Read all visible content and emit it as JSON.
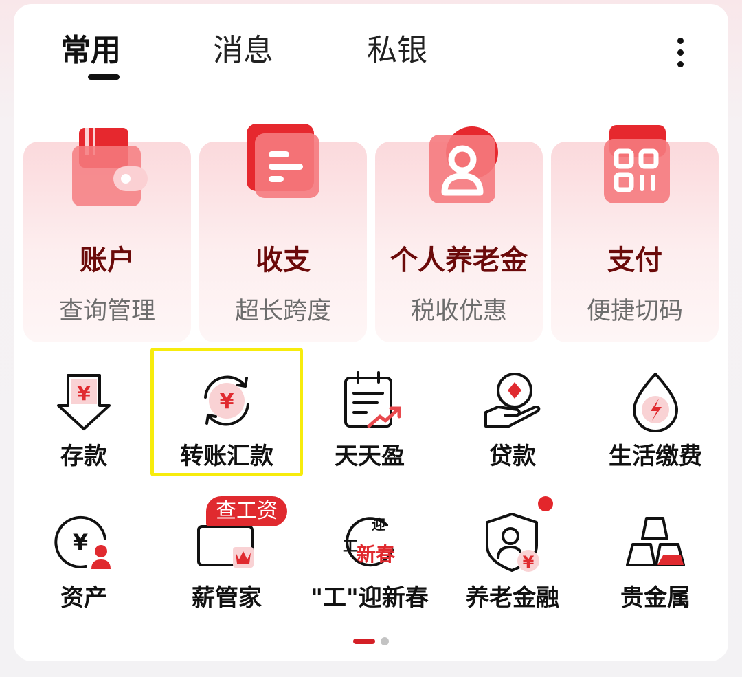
{
  "tabs": [
    {
      "label": "常用",
      "active": true
    },
    {
      "label": "消息",
      "active": false
    },
    {
      "label": "私银",
      "active": false
    }
  ],
  "feature_cards": [
    {
      "title": "账户",
      "subtitle": "查询管理",
      "icon": "wallet-icon"
    },
    {
      "title": "收支",
      "subtitle": "超长跨度",
      "icon": "statement-icon"
    },
    {
      "title": "个人养老金",
      "subtitle": "税收优惠",
      "icon": "person-icon"
    },
    {
      "title": "支付",
      "subtitle": "便捷切码",
      "icon": "qr-code-icon"
    }
  ],
  "grid_row1": [
    {
      "label": "存款",
      "icon": "deposit-icon"
    },
    {
      "label": "转账汇款",
      "icon": "transfer-icon",
      "highlighted": true
    },
    {
      "label": "天天盈",
      "icon": "calendar-chart-icon"
    },
    {
      "label": "贷款",
      "icon": "loan-hand-icon"
    },
    {
      "label": "生活缴费",
      "icon": "utility-drop-icon"
    }
  ],
  "grid_row2": [
    {
      "label": "资产",
      "icon": "asset-icon"
    },
    {
      "label": "薪管家",
      "icon": "salary-card-icon",
      "badge": "查工资"
    },
    {
      "label": "\"工\"迎新春",
      "icon": "new-year-icon",
      "icon_text": {
        "top": "迎",
        "left": "工",
        "main": "新春"
      }
    },
    {
      "label": "养老金融",
      "icon": "pension-shield-icon",
      "dot": true
    },
    {
      "label": "贵金属",
      "icon": "gold-bars-icon"
    }
  ],
  "currency_symbol": "¥",
  "colors": {
    "accent": "#e02a2f",
    "title_dark_red": "#6b0a0a",
    "highlight": "#f7ec0d"
  }
}
